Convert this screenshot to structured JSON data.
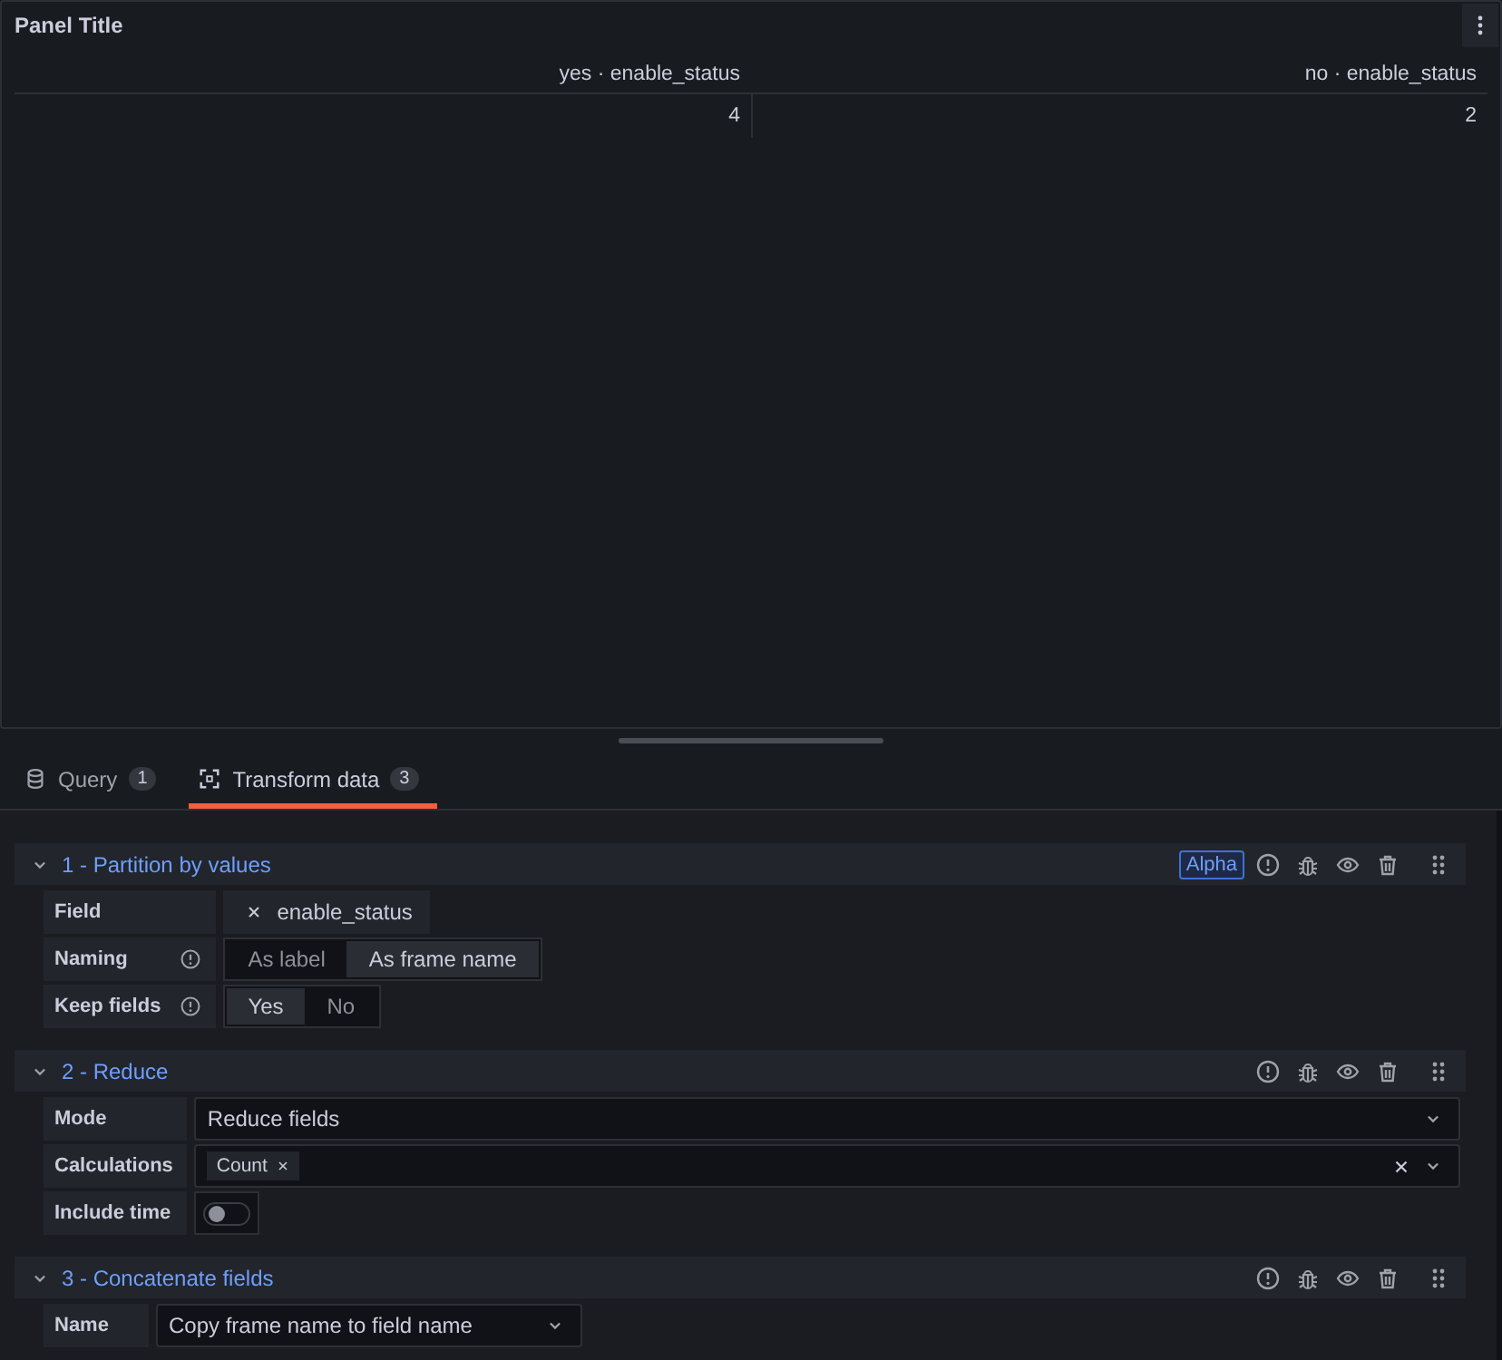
{
  "panel": {
    "title": "Panel Title",
    "table": {
      "columns": [
        "yes · enable_status",
        "no · enable_status"
      ],
      "rows": [
        [
          "4",
          "2"
        ]
      ]
    }
  },
  "tabs": [
    {
      "kind": "query",
      "label": "Query",
      "count": "1",
      "selected": false
    },
    {
      "kind": "transform",
      "label": "Transform data",
      "count": "3",
      "selected": true
    }
  ],
  "transformations": [
    {
      "title": "1 - Partition by values",
      "badge": "Alpha",
      "expanded": true,
      "options": [
        {
          "kind": "field-picker",
          "label": "Field",
          "info": false,
          "value": "enable_status"
        },
        {
          "kind": "radio",
          "label": "Naming",
          "info": true,
          "choices": [
            {
              "label": "As label",
              "selected": false
            },
            {
              "label": "As frame name",
              "selected": true
            }
          ]
        },
        {
          "kind": "radio",
          "label": "Keep fields",
          "info": true,
          "choices": [
            {
              "label": "Yes",
              "selected": true
            },
            {
              "label": "No",
              "selected": false
            }
          ]
        }
      ]
    },
    {
      "title": "2 - Reduce",
      "expanded": true,
      "options": [
        {
          "kind": "select",
          "label": "Mode",
          "info": false,
          "value": "Reduce fields",
          "full_width": true
        },
        {
          "kind": "multi-select",
          "label": "Calculations",
          "info": false,
          "chips": [
            "Count"
          ]
        },
        {
          "kind": "switch",
          "label": "Include time",
          "info": false,
          "on": false
        }
      ]
    },
    {
      "title": "3 - Concatenate fields",
      "expanded": true,
      "options": [
        {
          "kind": "select",
          "label": "Name",
          "info": false,
          "value": "Copy frame name to field name",
          "full_width": false
        }
      ]
    }
  ]
}
